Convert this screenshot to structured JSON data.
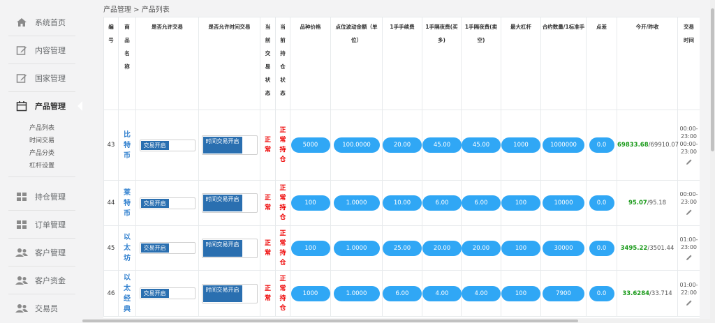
{
  "sidebar": {
    "items": [
      {
        "label": "系统首页",
        "icon": "home-icon"
      },
      {
        "label": "内容管理",
        "icon": "edit-icon"
      },
      {
        "label": "国家管理",
        "icon": "edit-icon"
      },
      {
        "label": "产品管理",
        "icon": "calendar-icon"
      },
      {
        "label": "持仓管理",
        "icon": "grid-icon"
      },
      {
        "label": "订单管理",
        "icon": "grid-icon"
      },
      {
        "label": "客户管理",
        "icon": "users-icon"
      },
      {
        "label": "客户资金",
        "icon": "users-icon"
      },
      {
        "label": "交易员",
        "icon": "users-icon"
      }
    ],
    "sub_items": [
      "产品列表",
      "时间交易",
      "产品分类",
      "杠杆设置"
    ]
  },
  "breadcrumb": "产品管理 > 产品列表",
  "table": {
    "headers": [
      "编号",
      "商品名称",
      "是否允许交易",
      "是否允许时间交易",
      "当前交易状态",
      "当前持仓状态",
      "品种价格",
      "点位波动金额（单位）",
      "1手手续费",
      "1手隔夜费(买多)",
      "1手隔夜费(卖空)",
      "最大杠杆",
      "合约数量/1标准手",
      "点差",
      "今开/昨收",
      "交易时间"
    ],
    "rows": [
      {
        "id": "43",
        "name": "比特币",
        "trade_toggle": "交易开启",
        "time_toggle": "时间交易开启",
        "trade_status": "正常",
        "hold_status": "正常持仓",
        "price": "5000",
        "point_value": "100.0000",
        "fee": "20.00",
        "overnight_buy": "45.00",
        "overnight_sell": "45.00",
        "leverage": "1000",
        "contract": "1000000",
        "spread": "0.0",
        "open": "69833.68",
        "close": "/69910.07",
        "times": [
          "00:00-23:00",
          "00:00-23:00"
        ]
      },
      {
        "id": "44",
        "name": "莱特币",
        "trade_toggle": "交易开启",
        "time_toggle": "时间交易开启",
        "trade_status": "正常",
        "hold_status": "正常持仓",
        "price": "100",
        "point_value": "1.0000",
        "fee": "10.00",
        "overnight_buy": "6.00",
        "overnight_sell": "6.00",
        "leverage": "100",
        "contract": "10000",
        "spread": "0.0",
        "open": "95.07",
        "close": "/95.18",
        "times": [
          "00:00-23:00"
        ]
      },
      {
        "id": "45",
        "name": "以太坊",
        "trade_toggle": "交易开启",
        "time_toggle": "时间交易开启",
        "trade_status": "正常",
        "hold_status": "正常持仓",
        "price": "100",
        "point_value": "1.0000",
        "fee": "25.00",
        "overnight_buy": "20.00",
        "overnight_sell": "20.00",
        "leverage": "100",
        "contract": "30000",
        "spread": "0.0",
        "open": "3495.22",
        "close": "/3501.44",
        "times": [
          "01:00-23:00"
        ]
      },
      {
        "id": "46",
        "name": "以太经典",
        "trade_toggle": "交易开启",
        "time_toggle": "时间交易开启",
        "trade_status": "正常",
        "hold_status": "正常持仓",
        "price": "1000",
        "point_value": "1.0000",
        "fee": "6.00",
        "overnight_buy": "4.00",
        "overnight_sell": "4.00",
        "leverage": "100",
        "contract": "7900",
        "spread": "0.0",
        "open": "33.6284",
        "close": "/33.714",
        "times": [
          "01:00-22:00"
        ]
      }
    ]
  },
  "colors": {
    "accent": "#30a7f5",
    "toggle_on": "#2a6fb0",
    "status_red": "#e00000",
    "price_green": "#1a9a1a",
    "name_blue": "#2f7fce"
  }
}
